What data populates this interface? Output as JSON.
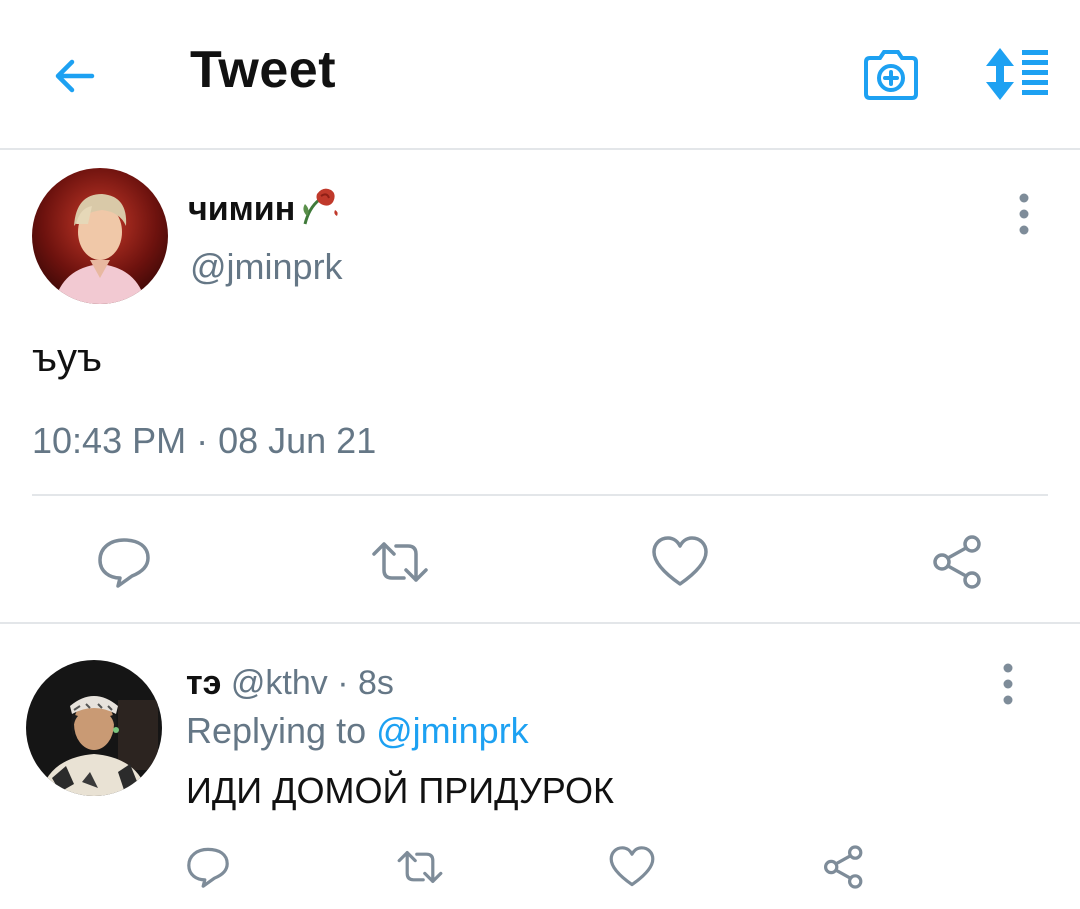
{
  "header": {
    "title": "Tweet",
    "icons": [
      "back-arrow-icon",
      "camera-add-icon",
      "sort-icon"
    ],
    "accent_color": "#1da1f2"
  },
  "tweet": {
    "display_name": "чимин",
    "name_emoji": "wilted-rose-icon",
    "handle": "@jminprk",
    "text": "ъуъ",
    "timestamp": "10:43 PM · 08 Jun 21",
    "actions": [
      "reply-icon",
      "retweet-icon",
      "like-icon",
      "share-icon"
    ]
  },
  "reply": {
    "display_name": "тэ",
    "handle": "@kthv",
    "time": "· 8s",
    "replying_prefix": "Replying to",
    "replying_handle": "@jminprk",
    "text": "ИДИ ДОМОЙ ПРИДУРОК",
    "actions": [
      "reply-icon",
      "retweet-icon",
      "like-icon",
      "share-icon"
    ]
  },
  "colors": {
    "secondary_text": "#657786",
    "divider": "#e3e6e9",
    "icon_gray": "#7e8c99"
  }
}
